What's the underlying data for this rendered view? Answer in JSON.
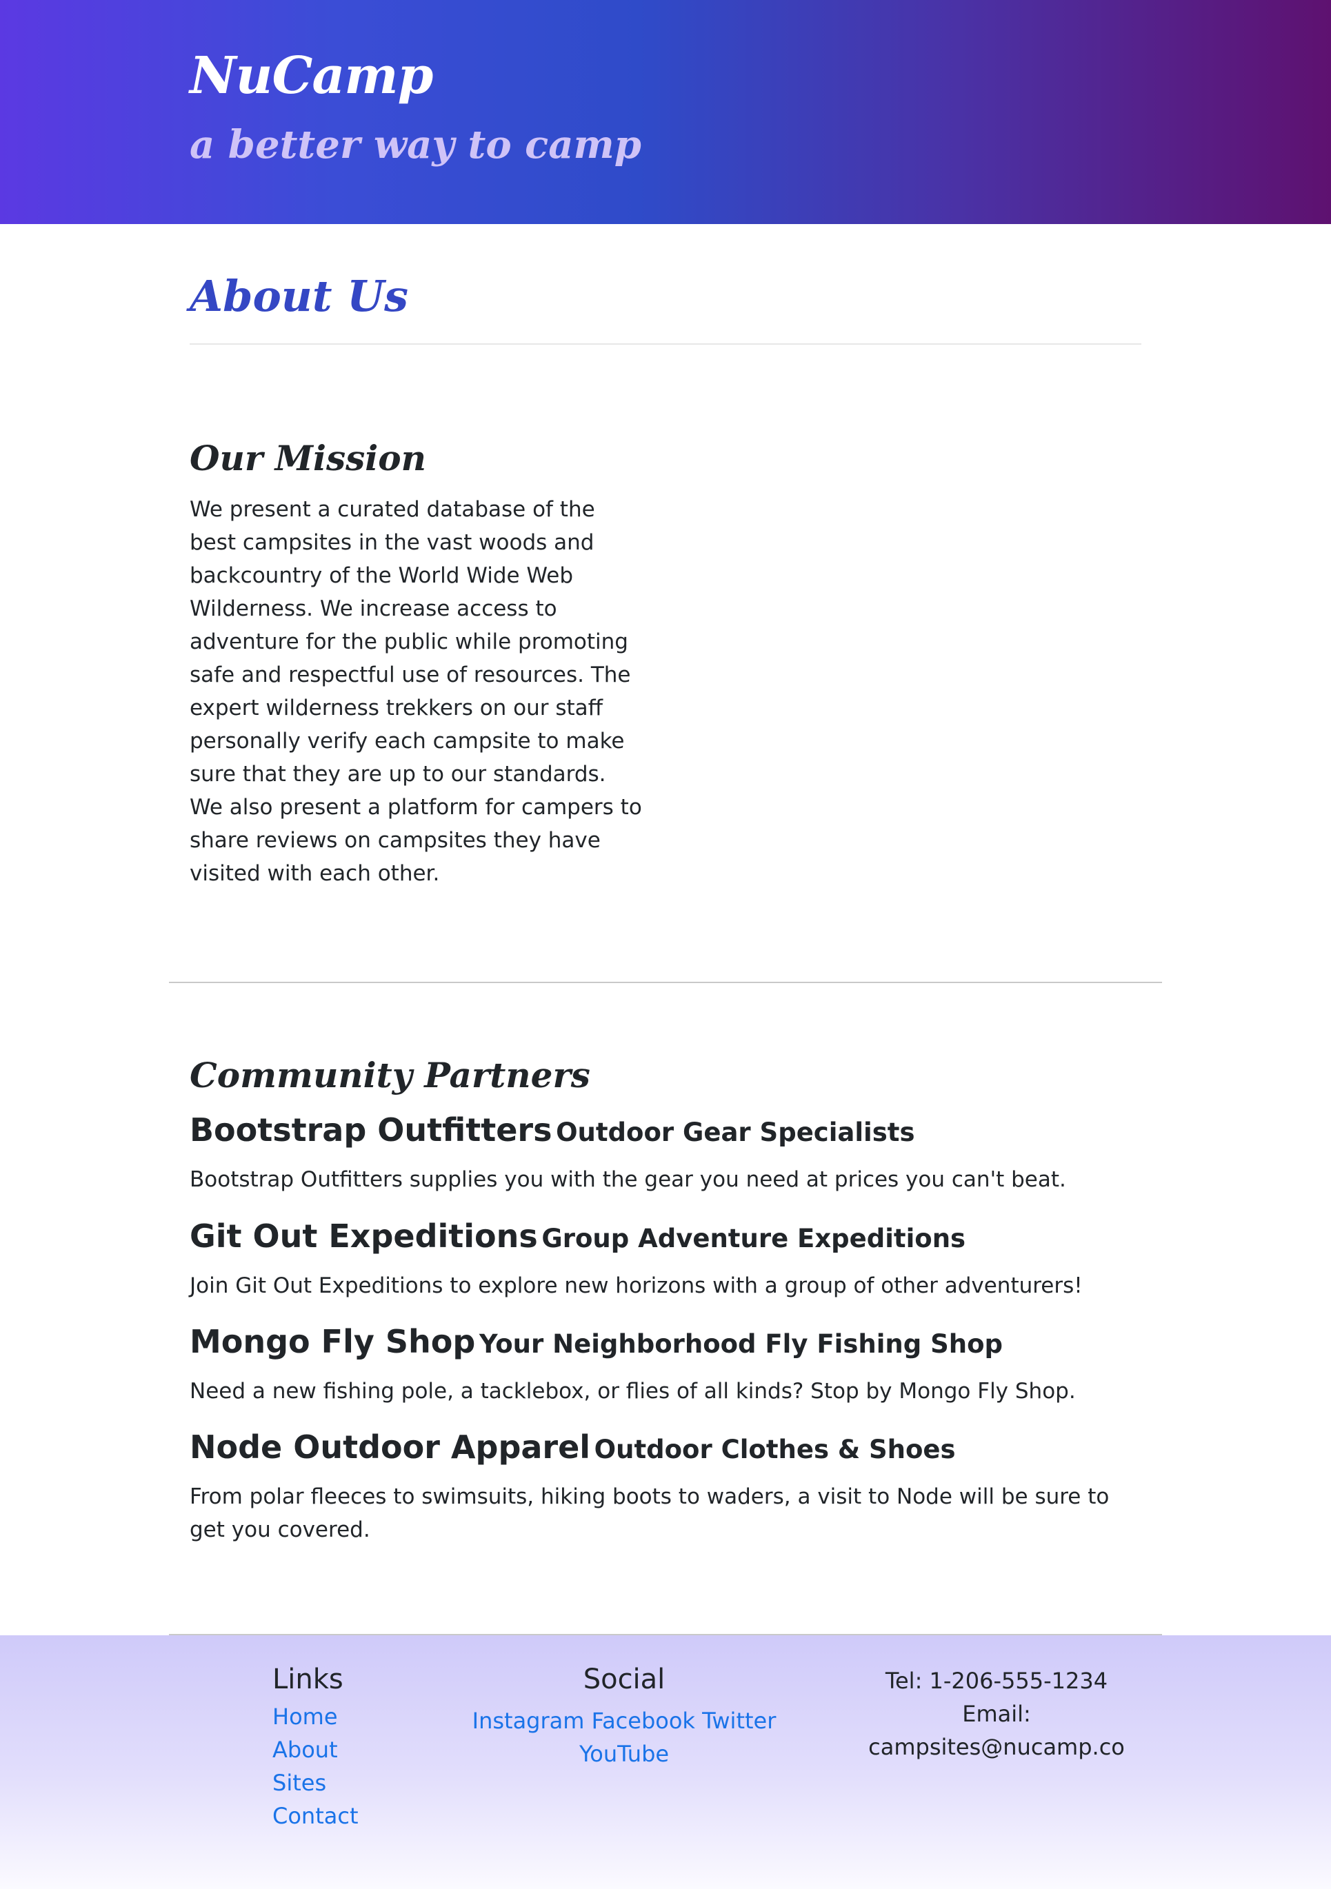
{
  "header": {
    "brand": "NuCamp",
    "tagline": "a better way to camp"
  },
  "page": {
    "title": "About Us"
  },
  "mission": {
    "heading": "Our Mission",
    "text": "We present a curated database of the best campsites in the vast woods and backcountry of the World Wide Web Wilderness. We increase access to adventure for the public while promoting safe and respectful use of resources. The expert wilderness trekkers on our staff personally verify each campsite to make sure that they are up to our standards. We also present a platform for campers to share reviews on campsites they have visited with each other."
  },
  "partners": {
    "heading": "Community Partners",
    "items": [
      {
        "name": "Bootstrap Outfitters",
        "tagline": "Outdoor Gear Specialists",
        "description": "Bootstrap Outfitters supplies you with the gear you need at prices you can't beat."
      },
      {
        "name": "Git Out Expeditions",
        "tagline": "Group Adventure Expeditions",
        "description": "Join Git Out Expeditions to explore new horizons with a group of other adventurers!"
      },
      {
        "name": "Mongo Fly Shop",
        "tagline": "Your Neighborhood Fly Fishing Shop",
        "description": "Need a new fishing pole, a tacklebox, or flies of all kinds? Stop by Mongo Fly Shop."
      },
      {
        "name": "Node Outdoor Apparel",
        "tagline": "Outdoor Clothes & Shoes",
        "description": "From polar fleeces to swimsuits, hiking boots to waders, a visit to Node will be sure to get you covered."
      }
    ]
  },
  "footer": {
    "links": {
      "heading": "Links",
      "items": [
        "Home",
        "About",
        "Sites",
        "Contact"
      ]
    },
    "social": {
      "heading": "Social",
      "items": [
        "Instagram",
        "Facebook",
        "Twitter",
        "YouTube"
      ]
    },
    "contact": {
      "tel": "Tel: 1-206-555-1234",
      "email_label": "Email:",
      "email": "campsites@nucamp.co"
    }
  },
  "colors": {
    "title_blue": "#3447c4",
    "link_blue": "#1a73e8",
    "header_gradient_start": "#5b39e2",
    "header_gradient_end": "#5e1170",
    "footer_tint": "#cfcaf9"
  }
}
